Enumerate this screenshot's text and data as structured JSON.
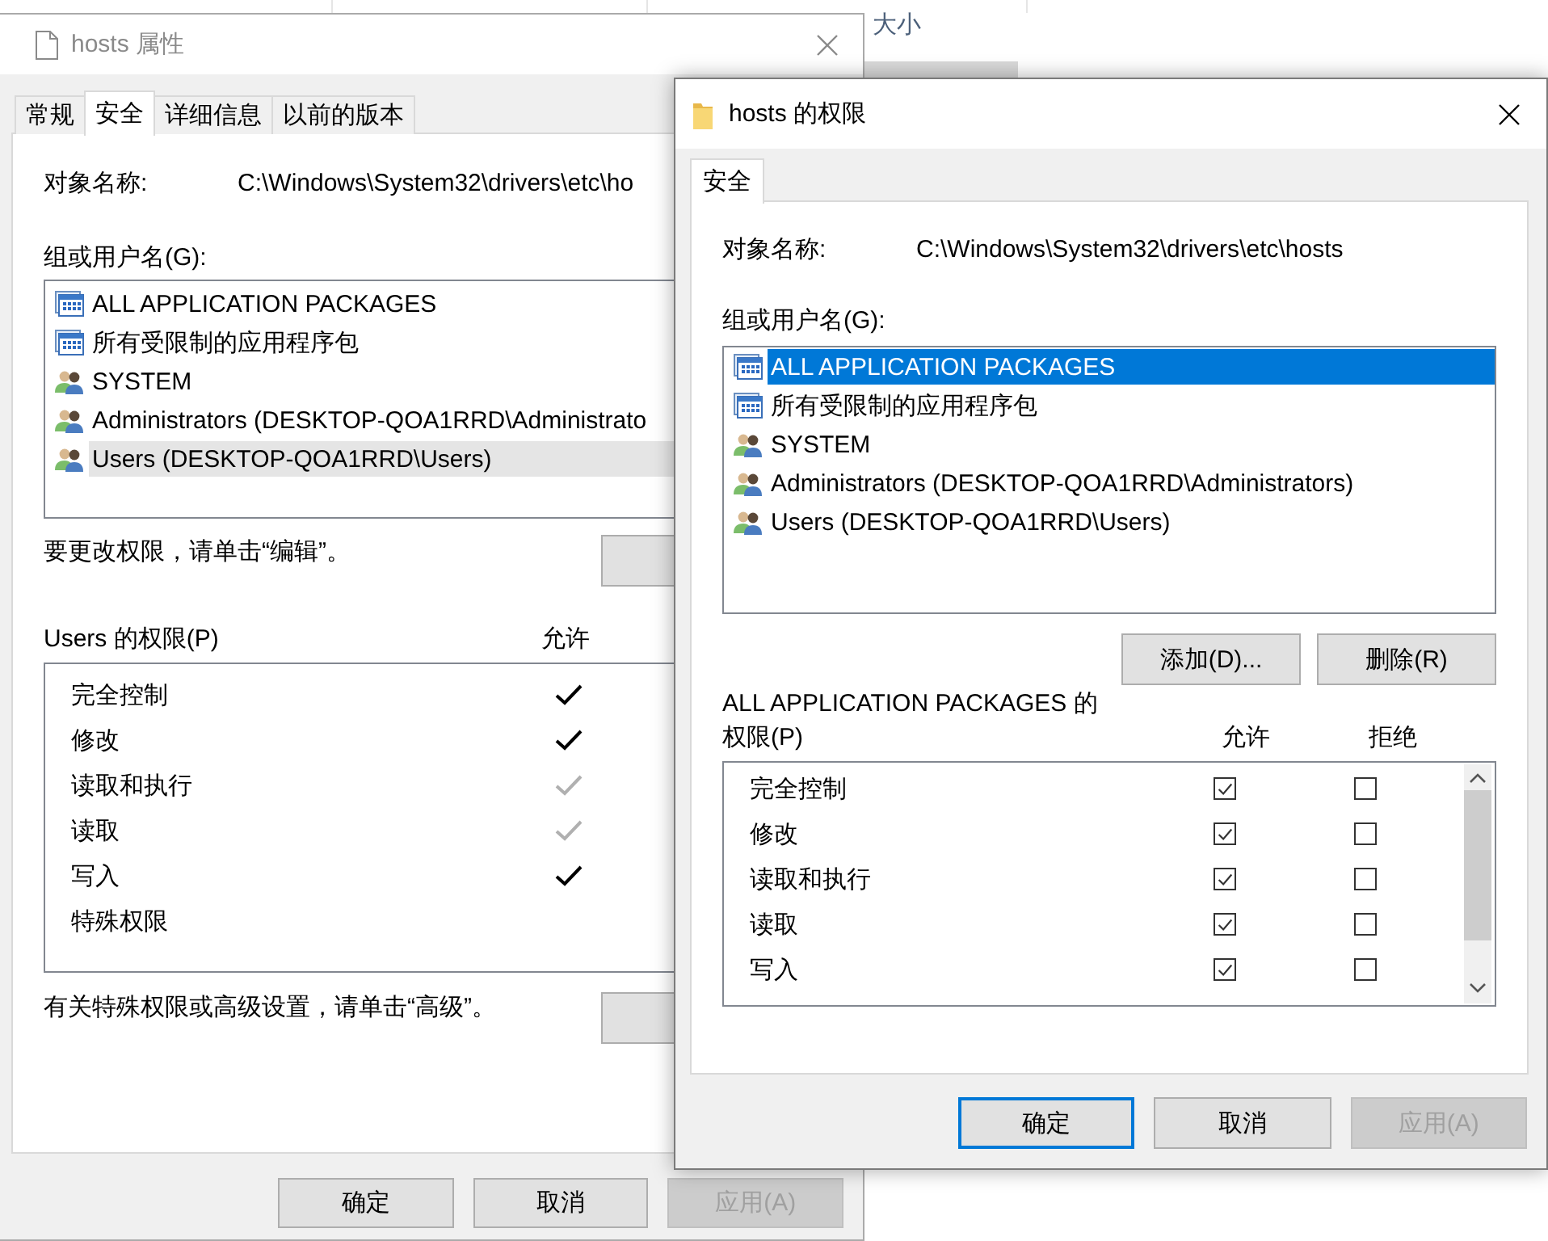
{
  "explorer": {
    "column_header": "大小"
  },
  "properties_window": {
    "title": "hosts 属性",
    "tabs": [
      {
        "label": "常规",
        "selected": false
      },
      {
        "label": "安全",
        "selected": true
      },
      {
        "label": "详细信息",
        "selected": false
      },
      {
        "label": "以前的版本",
        "selected": false
      }
    ],
    "object_name_label": "对象名称:",
    "object_name": "C:\\Windows\\System32\\drivers\\etc\\ho",
    "groups_label": "组或用户名(G):",
    "groups": [
      {
        "name": "ALL APPLICATION PACKAGES",
        "kind": "package",
        "selected": false
      },
      {
        "name": "所有受限制的应用程序包",
        "kind": "package",
        "selected": false
      },
      {
        "name": "SYSTEM",
        "kind": "users",
        "selected": false
      },
      {
        "name": "Administrators (DESKTOP-QOA1RRD\\Administrato",
        "kind": "users",
        "selected": false
      },
      {
        "name": "Users (DESKTOP-QOA1RRD\\Users)",
        "kind": "users",
        "selected": true
      }
    ],
    "edit_hint": "要更改权限，请单击“编辑”。",
    "permissions_label": "Users 的权限(P)",
    "allow_header": "允许",
    "permissions": [
      {
        "name": "完全控制",
        "allowed": true,
        "inherited": false
      },
      {
        "name": "修改",
        "allowed": true,
        "inherited": false
      },
      {
        "name": "读取和执行",
        "allowed": true,
        "inherited": true
      },
      {
        "name": "读取",
        "allowed": true,
        "inherited": true
      },
      {
        "name": "写入",
        "allowed": true,
        "inherited": false
      },
      {
        "name": "特殊权限",
        "allowed": false
      }
    ],
    "advanced_hint": "有关特殊权限或高级设置，请单击“高级”。",
    "buttons": [
      {
        "label": "确定",
        "default": false,
        "disabled": false
      },
      {
        "label": "取消",
        "default": false,
        "disabled": false
      },
      {
        "label": "应用(A)",
        "default": false,
        "disabled": true
      }
    ]
  },
  "permissions_window": {
    "title": "hosts 的权限",
    "tabs": [
      {
        "label": "安全",
        "selected": true
      }
    ],
    "object_name_label": "对象名称:",
    "object_name": "C:\\Windows\\System32\\drivers\\etc\\hosts",
    "groups_label": "组或用户名(G):",
    "groups": [
      {
        "name": "ALL APPLICATION PACKAGES",
        "kind": "package",
        "selected": true
      },
      {
        "name": "所有受限制的应用程序包",
        "kind": "package",
        "selected": false
      },
      {
        "name": "SYSTEM",
        "kind": "users",
        "selected": false
      },
      {
        "name": "Administrators (DESKTOP-QOA1RRD\\Administrators)",
        "kind": "users",
        "selected": false
      },
      {
        "name": "Users (DESKTOP-QOA1RRD\\Users)",
        "kind": "users",
        "selected": false
      }
    ],
    "group_buttons": [
      "添加(D)...",
      "删除(R)"
    ],
    "permissions_label": "ALL APPLICATION PACKAGES 的权限(P)",
    "allow_header": "允许",
    "deny_header": "拒绝",
    "permissions": [
      {
        "name": "完全控制",
        "allow": true,
        "deny": false
      },
      {
        "name": "修改",
        "allow": true,
        "deny": false
      },
      {
        "name": "读取和执行",
        "allow": true,
        "deny": false
      },
      {
        "name": "读取",
        "allow": true,
        "deny": false
      },
      {
        "name": "写入",
        "allow": true,
        "deny": false
      }
    ],
    "buttons": [
      {
        "label": "确定",
        "default": true,
        "disabled": false
      },
      {
        "label": "取消",
        "default": false,
        "disabled": false
      },
      {
        "label": "应用(A)",
        "default": false,
        "disabled": true
      }
    ]
  }
}
